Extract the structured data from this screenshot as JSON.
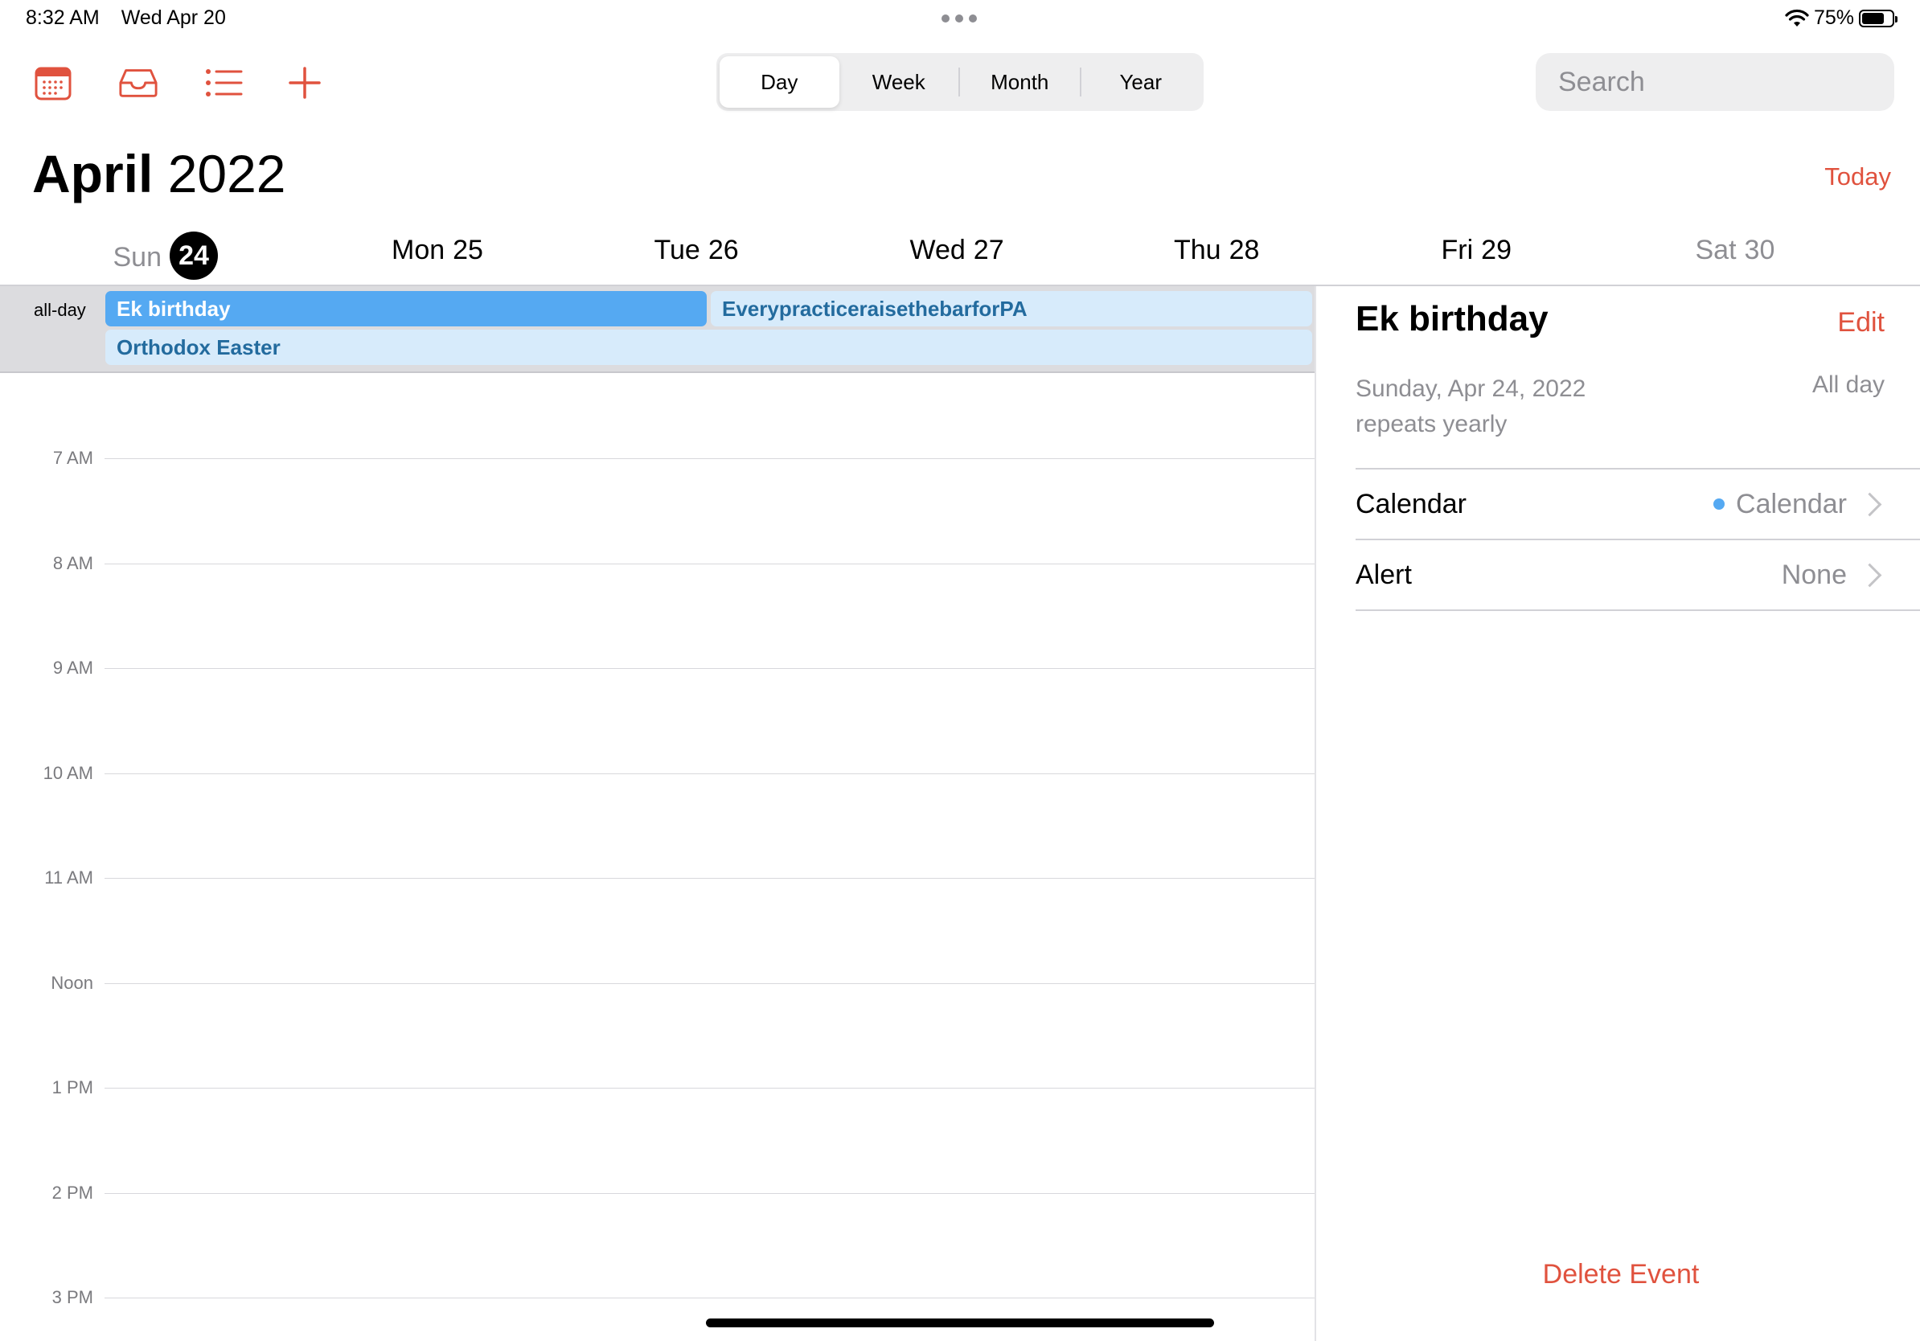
{
  "status_bar": {
    "time": "8:32 AM",
    "date": "Wed Apr 20",
    "battery": "75%",
    "battery_level": 0.75
  },
  "toolbar": {
    "icons": [
      "calendar-icon",
      "inbox-icon",
      "list-icon",
      "plus-icon"
    ],
    "segments": [
      {
        "label": "Day",
        "active": true
      },
      {
        "label": "Week",
        "active": false
      },
      {
        "label": "Month",
        "active": false
      },
      {
        "label": "Year",
        "active": false
      }
    ],
    "search_placeholder": "Search"
  },
  "header": {
    "month": "April",
    "year": "2022",
    "today_label": "Today"
  },
  "days": [
    {
      "name": "Sun",
      "num": "24",
      "selected": true,
      "weekend": true
    },
    {
      "name": "Mon",
      "num": "25",
      "selected": false,
      "weekend": false
    },
    {
      "name": "Tue",
      "num": "26",
      "selected": false,
      "weekend": false
    },
    {
      "name": "Wed",
      "num": "27",
      "selected": false,
      "weekend": false
    },
    {
      "name": "Thu",
      "num": "28",
      "selected": false,
      "weekend": false
    },
    {
      "name": "Fri",
      "num": "29",
      "selected": false,
      "weekend": false
    },
    {
      "name": "Sat",
      "num": "30",
      "selected": false,
      "weekend": true
    }
  ],
  "all_day": {
    "label": "all-day",
    "events": [
      {
        "title": "Ek birthday",
        "selected": true
      },
      {
        "title": "EverypracticeraisethebarforPA",
        "selected": false
      },
      {
        "title": "Orthodox Easter",
        "selected": false
      }
    ]
  },
  "hours": [
    "7 AM",
    "8 AM",
    "9 AM",
    "10 AM",
    "11 AM",
    "Noon",
    "1 PM",
    "2 PM",
    "3 PM"
  ],
  "detail": {
    "title": "Ek birthday",
    "edit_label": "Edit",
    "date": "Sunday, Apr 24, 2022",
    "repeat": "repeats yearly",
    "all_day": "All day",
    "calendar_label": "Calendar",
    "calendar_value": "Calendar",
    "calendar_color": "#55a9f2",
    "alert_label": "Alert",
    "alert_value": "None",
    "delete_label": "Delete Event"
  },
  "colors": {
    "accent": "#e0523e",
    "event_selected": "#55a9f2",
    "event_light": "#d7ebfb"
  }
}
